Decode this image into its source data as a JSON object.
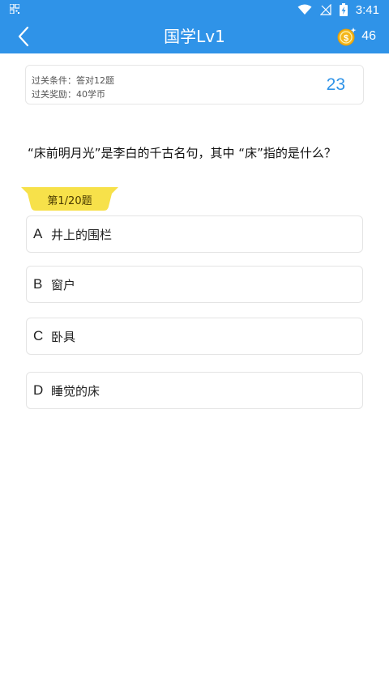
{
  "status_bar": {
    "time": "3:41"
  },
  "header": {
    "title": "国学Lv1",
    "coins": "46"
  },
  "info_card": {
    "condition": "过关条件：答对12题",
    "reward": "过关奖励：40学币",
    "timer": "23"
  },
  "question": {
    "text": "“床前明月光”是李白的千古名句，其中 “床”指的是什么？",
    "progress": "第1/20题"
  },
  "options": [
    {
      "letter": "A",
      "text": "井上的围栏"
    },
    {
      "letter": "B",
      "text": "窗户"
    },
    {
      "letter": "C",
      "text": "卧具"
    },
    {
      "letter": "D",
      "text": "睡觉的床"
    }
  ],
  "colors": {
    "primary": "#2f93e8",
    "ribbon": "#f7e14a",
    "coin": "#f3b51b"
  }
}
